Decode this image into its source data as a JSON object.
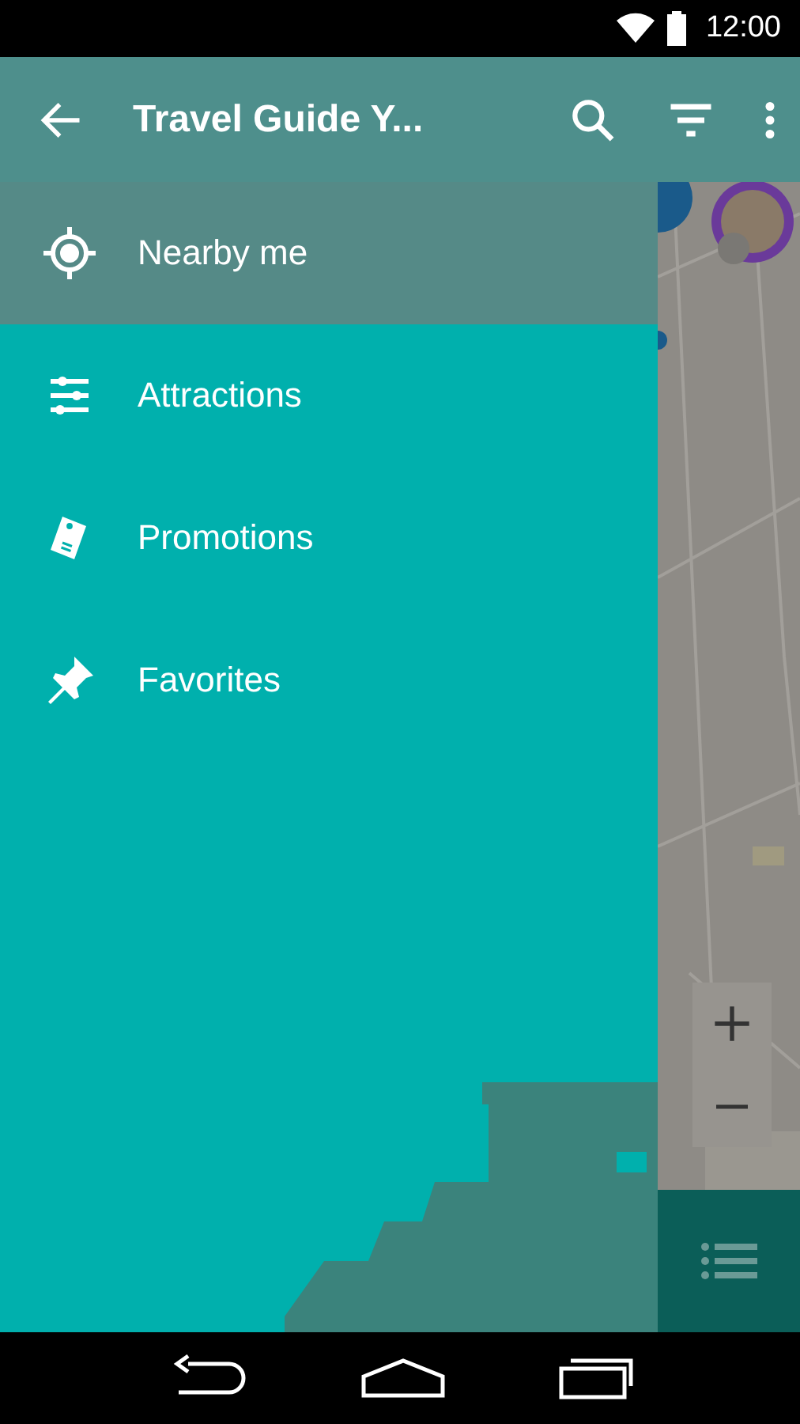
{
  "status_bar": {
    "time": "12:00"
  },
  "app_bar": {
    "title": "Travel Guide Y..."
  },
  "drawer": {
    "items": [
      {
        "label": "Nearby me",
        "kind": "location",
        "selected": true
      },
      {
        "label": "Attractions",
        "kind": "sliders",
        "selected": false
      },
      {
        "label": "Promotions",
        "kind": "tag",
        "selected": false
      },
      {
        "label": "Favorites",
        "kind": "pin",
        "selected": false
      }
    ]
  }
}
